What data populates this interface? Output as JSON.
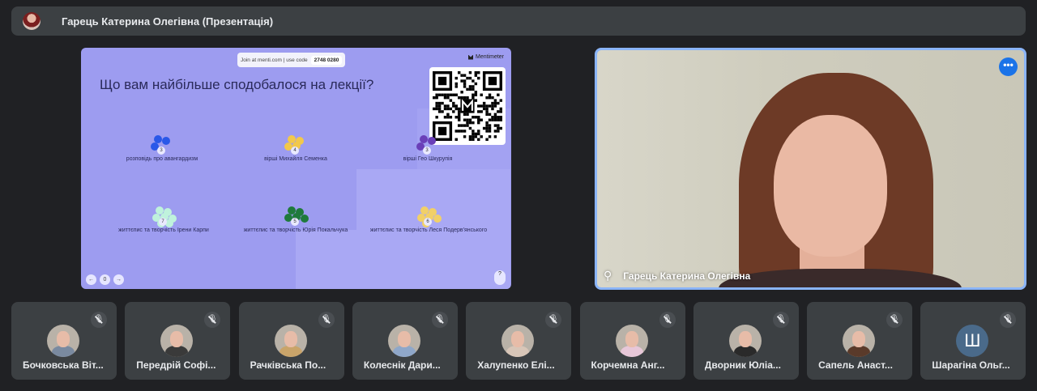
{
  "meeting": {
    "presenter_title": "Гарець Катерина Олегівна (Презентація)"
  },
  "slide": {
    "join_text": "Join at menti.com | use code",
    "join_code": "2748 0280",
    "brand": "Mentimeter",
    "question": "Що вам найбільше сподобалося на  лекції?",
    "options": [
      {
        "label": "розповідь про авангардизм",
        "count": "3",
        "color": "#2a58e8"
      },
      {
        "label": "вірші Михайля Семенка",
        "count": "4",
        "color": "#f2c84b"
      },
      {
        "label": "вірші Гео Шкурупія",
        "count": "3",
        "color": "#6a3fb8"
      },
      {
        "label": "життєпис та творчість Ірени Карпи",
        "count": "7",
        "color": "#bff2dc"
      },
      {
        "label": "життєпис та творчість Юрія Покальчука",
        "count": "5",
        "color": "#1f7a3c"
      },
      {
        "label": "життєпис та творчість Леся Подерв'янського",
        "count": "6",
        "color": "#f2d067"
      }
    ],
    "nav": [
      "←",
      "0",
      "→"
    ],
    "corner": "?"
  },
  "speaker": {
    "name": "Гарець Катерина Олегівна",
    "more_glyph": "•••",
    "pin_glyph": "⚲"
  },
  "participants": [
    {
      "name": "Бочковська Віт...",
      "avatar": "photo",
      "shirt": "#7a8aa0"
    },
    {
      "name": "Передрій Софі...",
      "avatar": "photo",
      "shirt": "#3a3a3a"
    },
    {
      "name": "Рачківська По...",
      "avatar": "photo",
      "shirt": "#c9a46a"
    },
    {
      "name": "Колеснік Дари...",
      "avatar": "photo",
      "shirt": "#8fa7c9"
    },
    {
      "name": "Халупенко Елі...",
      "avatar": "photo",
      "shirt": "#d8c6b8"
    },
    {
      "name": "Корчемна Анг...",
      "avatar": "photo",
      "shirt": "#e7c7d8"
    },
    {
      "name": "Дворник Юліа...",
      "avatar": "photo",
      "shirt": "#2a2a2a"
    },
    {
      "name": "Сапель Анаст...",
      "avatar": "photo",
      "shirt": "#5a3a2a"
    },
    {
      "name": "Шарагіна Ольг...",
      "avatar": "letter",
      "letter": "Ш"
    }
  ],
  "colors": {
    "accent": "#1a73e8",
    "tile_bg": "#3c4043",
    "slide_bg": "#9d9cf0"
  }
}
